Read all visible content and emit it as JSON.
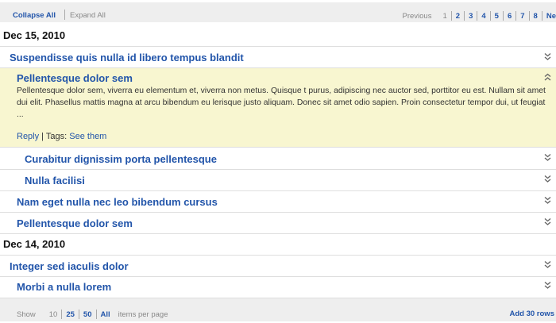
{
  "toolbar": {
    "collapse_all": "Collapse All",
    "expand_all": "Expand All"
  },
  "pager": {
    "previous": "Previous",
    "pages": [
      "1",
      "2",
      "3",
      "4",
      "5",
      "6",
      "7",
      "8"
    ],
    "current_page": "1",
    "next": "Ne"
  },
  "groups": [
    {
      "date": "Dec 15, 2010"
    },
    {
      "date": "Dec 14, 2010"
    }
  ],
  "threads": [
    {
      "title": "Suspendisse quis nulla id libero tempus blandit",
      "level": 0
    },
    {
      "title": "Pellentesque dolor sem",
      "level": 1,
      "expanded": true,
      "body": "Pellentesque dolor sem, viverra eu elementum et, viverra non metus. Quisque t purus, adipiscing nec auctor sed, porttitor eu est. Nullam sit amet dui elit. Phasellus mattis magna at arcu bibendum eu lerisque justo aliquam. Donec sit amet odio sapien. Proin consectetur tempor dui, ut feugiat ...",
      "reply": "Reply",
      "separator": " | ",
      "tags_label": "Tags: ",
      "tags_link": "See them"
    },
    {
      "title": "Curabitur dignissim porta pellentesque",
      "level": 2
    },
    {
      "title": "Nulla facilisi",
      "level": 2
    },
    {
      "title": "Nam eget nulla nec leo bibendum cursus",
      "level": 1
    },
    {
      "title": "Pellentesque dolor sem",
      "level": 1
    },
    {
      "title": "Integer sed iaculis dolor",
      "level": 0
    },
    {
      "title": "Morbi a nulla lorem",
      "level": 1
    }
  ],
  "footer": {
    "show_label": "Show",
    "options": [
      "10",
      "25",
      "50",
      "All"
    ],
    "current_option": "10",
    "suffix": "items per page",
    "add_rows": "Add 30 rows"
  },
  "colors": {
    "link": "#2255aa",
    "expanded_bg": "#f8f6d0",
    "bar_bg": "#eeeeee"
  }
}
